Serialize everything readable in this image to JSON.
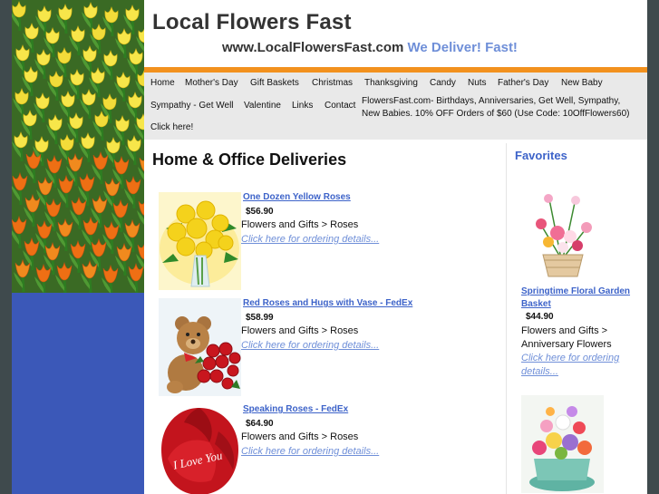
{
  "header": {
    "title": "Local Flowers Fast",
    "url": "www.LocalFlowersFast.com",
    "slogan": "We Deliver! Fast!"
  },
  "nav": {
    "items": [
      "Home",
      "Mother's Day",
      "Gift Baskets",
      "Christmas",
      "Thanksgiving",
      "Candy",
      "Nuts",
      "Father's Day",
      "New Baby",
      "Sympathy - Get Well",
      "Valentine",
      "Links",
      "Contact",
      "Click here!"
    ],
    "note": "FlowersFast.com- Birthdays, Anniversaries, Get Well, Sympathy, New Babies. 10% OFF Orders of $60 (Use Code: 10OffFlowers60)"
  },
  "main": {
    "title": "Home & Office Deliveries",
    "products": [
      {
        "name": " One Dozen Yellow Roses ",
        "price": "$56.90",
        "category": "Flowers and Gifts > Roses",
        "link": "Click here for ordering details..."
      },
      {
        "name": " Red Roses and Hugs with Vase - FedEx ",
        "price": "$58.99",
        "category": "Flowers and Gifts > Roses",
        "link": "Click here for ordering details..."
      },
      {
        "name": " Speaking Roses - FedEx ",
        "price": "$64.90",
        "category": "Flowers and Gifts > Roses",
        "link": "Click here for ordering details...",
        "image_text": "I Love You"
      }
    ]
  },
  "sidebar": {
    "title": "Favorites",
    "favorite": {
      "name": "Springtime Floral Garden Basket",
      "price": "$44.90",
      "category": "Flowers and Gifts > Anniversary Flowers",
      "link": "Click here for ordering details..."
    }
  },
  "colors": {
    "accent_orange": "#f2911e",
    "link_blue": "#3d63c9",
    "link_light": "#6f8fd8",
    "left_column_blue": "#3b58b8",
    "nav_background": "#e9e9e9"
  }
}
